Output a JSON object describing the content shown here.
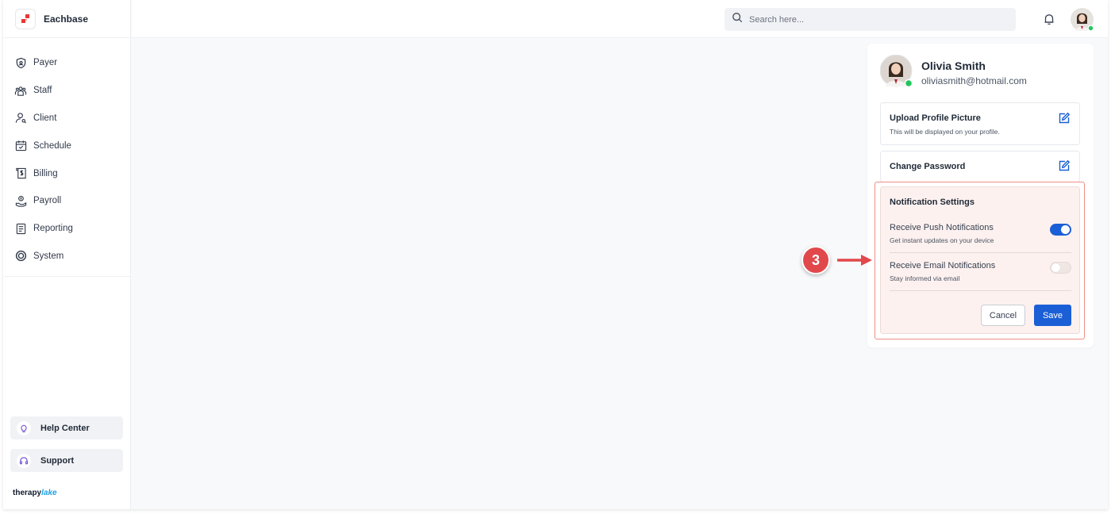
{
  "app": {
    "brand_name": "Eachbase",
    "footer_brand_a": "therapy",
    "footer_brand_b": "lake"
  },
  "sidebar": {
    "items": [
      {
        "label": "Payer",
        "icon": "shield-icon"
      },
      {
        "label": "Staff",
        "icon": "staff-icon"
      },
      {
        "label": "Client",
        "icon": "client-icon"
      },
      {
        "label": "Schedule",
        "icon": "calendar-icon"
      },
      {
        "label": "Billing",
        "icon": "billing-icon"
      },
      {
        "label": "Payroll",
        "icon": "payroll-icon"
      },
      {
        "label": "Reporting",
        "icon": "report-icon"
      },
      {
        "label": "System",
        "icon": "system-icon"
      }
    ],
    "help_center": "Help Center",
    "support": "Support"
  },
  "topbar": {
    "search_placeholder": "Search here..."
  },
  "profile": {
    "name": "Olivia Smith",
    "email": "oliviasmith@hotmail.com",
    "upload_title": "Upload Profile Picture",
    "upload_sub": "This will be displayed on your profile.",
    "change_password": "Change Password"
  },
  "notifications": {
    "title": "Notification Settings",
    "push_title": "Receive Push Notifications",
    "push_sub": "Get instant updates on your device",
    "push_enabled": true,
    "email_title": "Receive Email Notifications",
    "email_sub": "Stay informed via email",
    "email_enabled": false,
    "cancel": "Cancel",
    "save": "Save"
  },
  "annotation": {
    "step": "3"
  },
  "colors": {
    "primary": "#1b5fd6",
    "accent_red": "#e1484b",
    "highlight_bg": "#fdf1ef",
    "online": "#22c55e"
  }
}
